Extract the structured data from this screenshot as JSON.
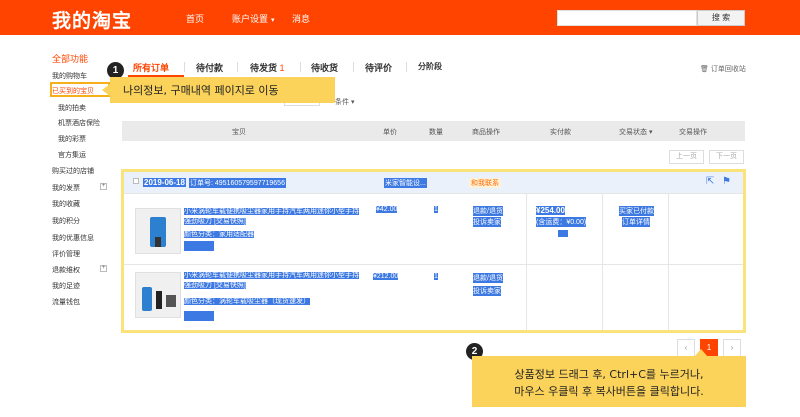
{
  "header": {
    "logo": "我的淘宝",
    "nav": [
      "首页",
      "账户设置",
      "消息"
    ],
    "search_button": "搜 索"
  },
  "sidebar": {
    "title": "全部功能",
    "items": [
      "我的购物车",
      "已买到的宝贝",
      "我的拍卖",
      "机票酒店保险",
      "我的彩票",
      "官方集运",
      "购买过的店铺",
      "我的发票",
      "我的收藏",
      "我的积分",
      "我的优惠信息",
      "评价管理",
      "退款维权",
      "我的足迹",
      "流量钱包"
    ]
  },
  "tabs": [
    {
      "label": "所有订单",
      "count": ""
    },
    {
      "label": "待付款",
      "count": ""
    },
    {
      "label": "待发货",
      "count": "1"
    },
    {
      "label": "待收货",
      "count": ""
    },
    {
      "label": "待评价",
      "count": ""
    },
    {
      "label": "分阶段",
      "count": ""
    }
  ],
  "recycle_link": "订单回收站",
  "filter_label": "条件",
  "tooltip1": {
    "number": "1",
    "text": "나의정보, 구매내역 페이지로 이동"
  },
  "table_header": [
    "宝贝",
    "单价",
    "数量",
    "商品操作",
    "实付款",
    "交易状态",
    "交易操作"
  ],
  "pager": {
    "prev": "上一页",
    "next": "下一页"
  },
  "order": {
    "date": "2019-06-18",
    "order_no": "订单号: 495160579597719656",
    "shop": "米家智能设...",
    "contact": "和我联系",
    "items": [
      {
        "title": "小米涡轮车载便携吸尘器家用手持汽车两用迷你小型手持强劲吸力 [交易快照]",
        "sku": "颜色分类：家用适配器",
        "price": "¥42.00",
        "qty": "1",
        "ops": [
          "退款/退货",
          "投诉卖家"
        ]
      },
      {
        "title": "小米涡轮车载便携吸尘器家用手持汽车两用迷你小型手持强劲吸力 [交易快照]",
        "sku": "颜色分类：涡轮车载吸尘器（现货速发）",
        "price": "¥212.00",
        "qty": "1",
        "ops": [
          "退款/退货",
          "投诉卖家"
        ]
      }
    ],
    "total": "¥254.00",
    "total_note": "(含运费：¥0.00)",
    "status": [
      "买家已付款",
      "订单详情"
    ]
  },
  "pagination": {
    "prev": "‹",
    "current": "1",
    "next": "›"
  },
  "tooltip2": {
    "number": "2",
    "line1": "상품정보 드래그 후, Ctrl+C를 누르거나,",
    "line2": "마우스 우클릭 후 복사버튼을 클릭합니다."
  },
  "colors": {
    "brand": "#ff4400",
    "selection": "#3d79e2",
    "tooltip": "#fbd25a"
  }
}
